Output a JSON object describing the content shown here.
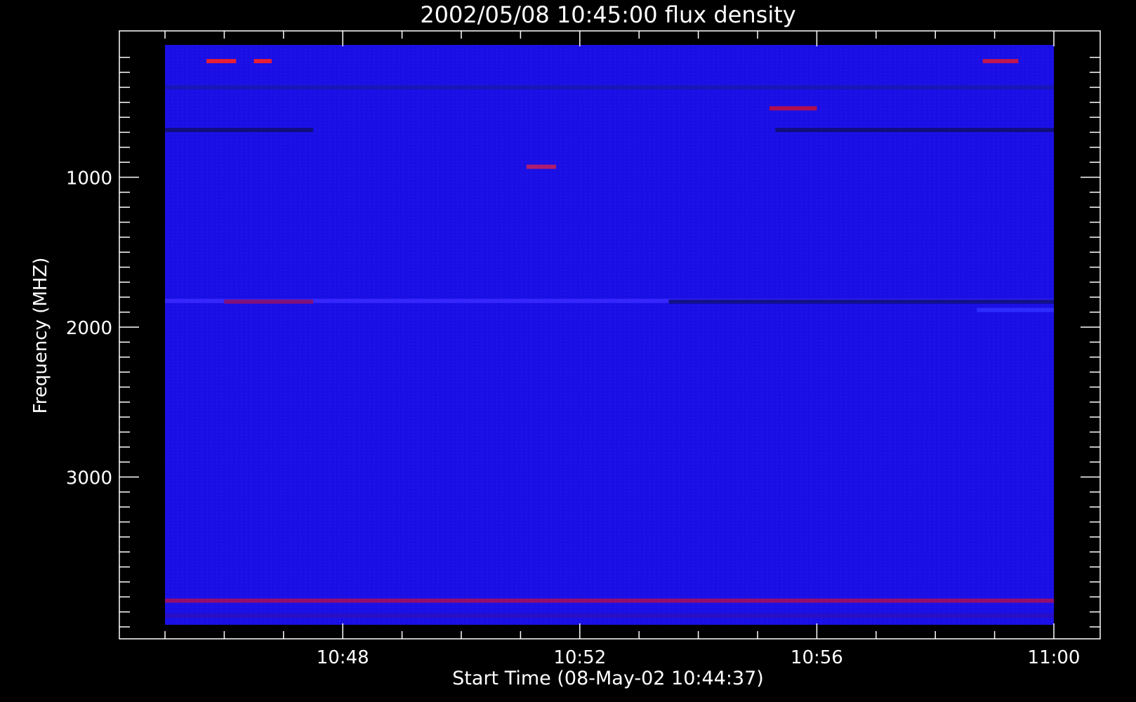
{
  "chart_data": {
    "type": "heatmap",
    "title": "2002/05/08 10:45:00 flux density",
    "xlabel": "Start Time (08-May-02 10:44:37)",
    "ylabel": "Frequency (MHZ)",
    "x_tick_labels": [
      "10:48",
      "10:52",
      "10:56",
      "11:00"
    ],
    "y_tick_labels": [
      "1000",
      "2000",
      "3000"
    ],
    "x_range": [
      "10:44:37",
      "11:01:30"
    ],
    "data_time_range": [
      "10:45:00",
      "11:00:00"
    ],
    "y_range_mhz": [
      100,
      4100
    ],
    "data_frequency_range_mhz": [
      195,
      4070
    ],
    "x_major_minutes": [
      48,
      52,
      56,
      60
    ],
    "x_minor_minutes": [
      45,
      46,
      47,
      49,
      50,
      51,
      53,
      54,
      55,
      57,
      58,
      59
    ],
    "y_major_mhz": [
      1000,
      2000,
      3000
    ],
    "y_minor_mhz": [
      200,
      300,
      400,
      500,
      600,
      700,
      800,
      900,
      1100,
      1200,
      1300,
      1400,
      1500,
      1600,
      1700,
      1800,
      1900,
      2100,
      2200,
      2300,
      2400,
      2500,
      2600,
      2700,
      2800,
      2900,
      3100,
      3200,
      3300,
      3400,
      3500,
      3600,
      3700,
      3800,
      3900,
      4000
    ],
    "background_color": "#1a10e6",
    "features": [
      {
        "kind": "band",
        "freq_mhz": 1825,
        "t_start_min": 45,
        "t_end_min": 60,
        "color": "#3a2aff"
      },
      {
        "kind": "band",
        "freq_mhz": 1830,
        "t_start_min": 46,
        "t_end_min": 47.5,
        "color": "#8a1070"
      },
      {
        "kind": "band",
        "freq_mhz": 1830,
        "t_start_min": 53.5,
        "t_end_min": 60,
        "color": "#101080"
      },
      {
        "kind": "band",
        "freq_mhz": 1885,
        "t_start_min": 58.7,
        "t_end_min": 60,
        "color": "#3030ff"
      },
      {
        "kind": "band",
        "freq_mhz": 400,
        "t_start_min": 45,
        "t_end_min": 60,
        "color": "#1818b0"
      },
      {
        "kind": "band",
        "freq_mhz": 685,
        "t_start_min": 45,
        "t_end_min": 47.5,
        "color": "#101070"
      },
      {
        "kind": "band",
        "freq_mhz": 685,
        "t_start_min": 55.3,
        "t_end_min": 60,
        "color": "#101070"
      },
      {
        "kind": "band",
        "freq_mhz": 225,
        "t_start_min": 45.7,
        "t_end_min": 46.2,
        "color": "#ff2020"
      },
      {
        "kind": "band",
        "freq_mhz": 225,
        "t_start_min": 46.5,
        "t_end_min": 46.8,
        "color": "#ff2020"
      },
      {
        "kind": "band",
        "freq_mhz": 225,
        "t_start_min": 58.8,
        "t_end_min": 59.4,
        "color": "#d01840"
      },
      {
        "kind": "band",
        "freq_mhz": 540,
        "t_start_min": 55.2,
        "t_end_min": 56,
        "color": "#c01040"
      },
      {
        "kind": "band",
        "freq_mhz": 930,
        "t_start_min": 51.1,
        "t_end_min": 51.6,
        "color": "#c02060"
      },
      {
        "kind": "band",
        "freq_mhz": 3825,
        "t_start_min": 45,
        "t_end_min": 60,
        "color": "#a01060"
      },
      {
        "kind": "band",
        "freq_mhz": 3925,
        "t_start_min": 45,
        "t_end_min": 60,
        "color": "#2a10c0"
      }
    ]
  }
}
